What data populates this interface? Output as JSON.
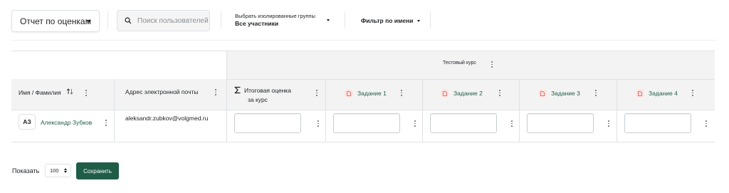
{
  "toolbar": {
    "report_select_value": "Отчет по оценкам",
    "search_placeholder": "Поиск пользователей",
    "groups_label": "Выбрать изолированные группы",
    "groups_value": "Все участники",
    "name_filter_label": "Фильтр по имени"
  },
  "grader": {
    "course_name": "Тестовый курс",
    "columns": {
      "name": "Имя / Фамилия",
      "email": "Адрес электронной почты",
      "total_line1": "Итоговая оценка",
      "total_line2": "за курс"
    },
    "assignments": [
      {
        "label": "Задание 1"
      },
      {
        "label": "Задание 2"
      },
      {
        "label": "Задание 3"
      },
      {
        "label": "Задание 4"
      }
    ],
    "rows": [
      {
        "initials": "АЗ",
        "fullname": "Александр Зубков",
        "email": "aleksandr.zubkov@volgmed.ru"
      }
    ]
  },
  "footer": {
    "show_label": "Показать",
    "per_page_value": "100",
    "save_label": "Сохранить"
  },
  "colors": {
    "brand": "#1f5d47",
    "header_bg": "#f3f3f3",
    "assignment_icon_bg": "#fde4e1"
  },
  "icons": {
    "search": "search-icon",
    "sort": "sort-icon",
    "sigma": "sigma-icon",
    "assignment": "assignment-icon",
    "kebab": "kebab-menu-icon"
  }
}
